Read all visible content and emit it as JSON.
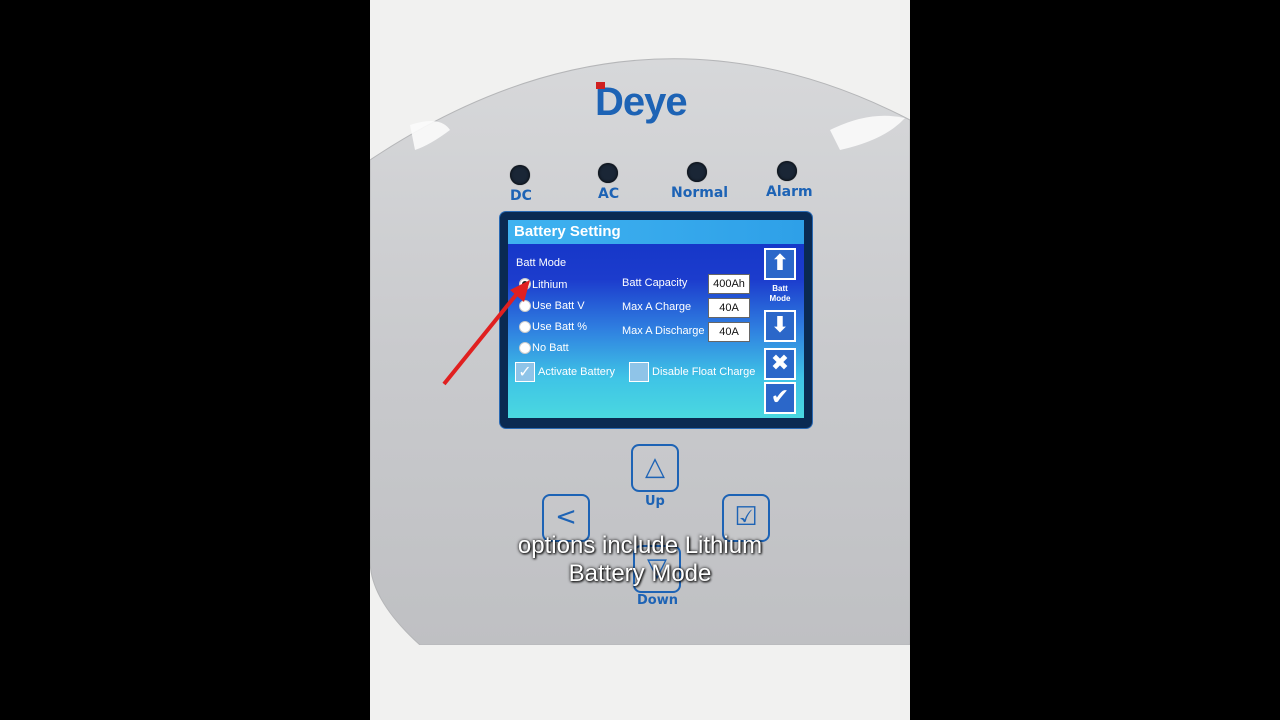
{
  "device": {
    "brand": "Deye",
    "indicators": [
      "DC",
      "AC",
      "Normal",
      "Alarm"
    ]
  },
  "lcd": {
    "title": "Battery Setting",
    "batt_mode_label": "Batt Mode",
    "modes": [
      "Lithium",
      "Use Batt V",
      "Use Batt %",
      "No Batt"
    ],
    "selected_mode": "Lithium",
    "fields": [
      {
        "label": "Batt Capacity",
        "value": "400Ah"
      },
      {
        "label": "Max A Charge",
        "value": "40A"
      },
      {
        "label": "Max A Discharge",
        "value": "40A"
      }
    ],
    "activate_battery_label": "Activate Battery",
    "activate_battery_checked": true,
    "disable_float_label": "Disable Float Charge",
    "disable_float_checked": false,
    "side_label": "Batt Mode"
  },
  "keys": {
    "up_label": "Up",
    "down_label": "Down"
  },
  "caption": {
    "line1": "options include Lithium",
    "line2": "Battery Mode"
  },
  "colors": {
    "brand_blue": "#1d63b5",
    "lcd_blue": "#1c3ccd",
    "annotation_arrow": "#e02020"
  }
}
